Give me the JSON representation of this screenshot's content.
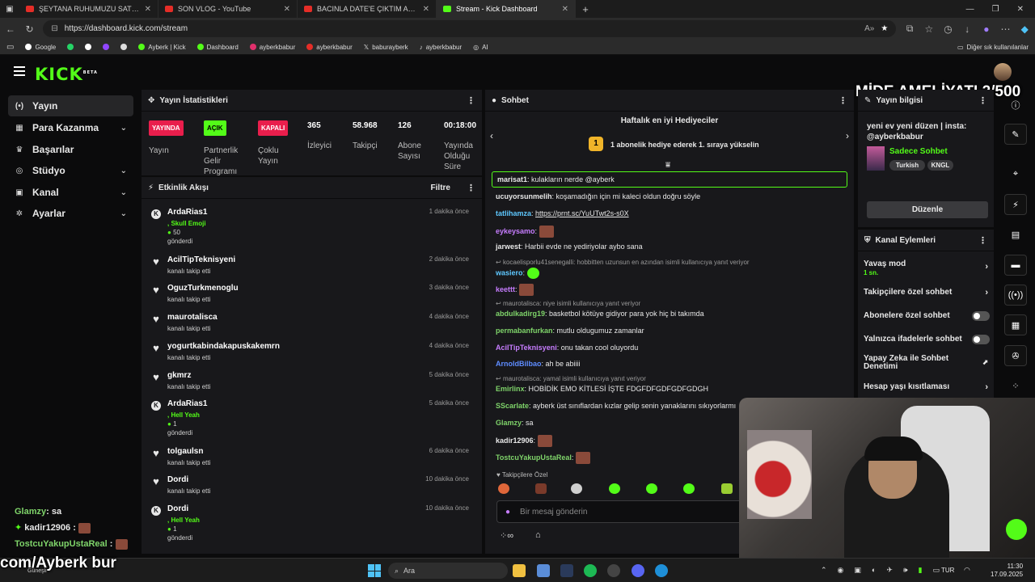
{
  "browser": {
    "tabs": [
      {
        "title": "ŞEYTANA RUHUMUZU SATTIK - Y",
        "kind": "yt"
      },
      {
        "title": "SON VLOG - YouTube",
        "kind": "yt"
      },
      {
        "title": "BACINLA DATE'E ÇIKTIM ALİ BİÇİM",
        "kind": "yt"
      },
      {
        "title": "Stream - Kick Dashboard",
        "kind": "kick"
      }
    ],
    "url": "https://dashboard.kick.com/stream",
    "bookmarks": [
      "Google",
      "Ayberk | Kick",
      "Dashboard",
      "ayberkbabur",
      "ayberkbabur",
      "baburayberk",
      "ayberkbabur",
      "AI"
    ],
    "bookmarks_other": "Diğer sık kullanılanlar"
  },
  "overlay": {
    "title": "MİDE AMELİYATI 2/500",
    "watermark": "com/Ayberk bur"
  },
  "sidebar": {
    "items": [
      {
        "label": "Yayın",
        "icon": "broadcast-icon",
        "glyph": "(•)",
        "active": true,
        "chevron": false
      },
      {
        "label": "Para Kazanma",
        "icon": "money-icon",
        "glyph": "▦",
        "active": false,
        "chevron": true
      },
      {
        "label": "Başarılar",
        "icon": "trophy-icon",
        "glyph": "♛",
        "active": false,
        "chevron": false
      },
      {
        "label": "Stüdyo",
        "icon": "studio-icon",
        "glyph": "◎",
        "active": false,
        "chevron": true
      },
      {
        "label": "Kanal",
        "icon": "channel-icon",
        "glyph": "▣",
        "active": false,
        "chevron": true
      },
      {
        "label": "Ayarlar",
        "icon": "settings-icon",
        "glyph": "✲",
        "active": false,
        "chevron": true
      }
    ],
    "mini_chat": [
      {
        "user": "Glamzy",
        "text": ": sa",
        "color": "#7fd46a"
      },
      {
        "user": "kadir12906",
        "text": " :",
        "color": "#e8e8e8"
      },
      {
        "user": "TostcuYakupUstaReal",
        "text": " :",
        "color": "#7fd46a"
      }
    ]
  },
  "stats": {
    "title": "Yayın İstatistikleri",
    "items": [
      {
        "badge": "YAYINDA",
        "badge_color": "red",
        "label": "Yayın"
      },
      {
        "badge": "AÇIK",
        "badge_color": "green",
        "label": "Partnerlik Gelir Programı"
      },
      {
        "badge": "KAPALI",
        "badge_color": "red",
        "label": "Çoklu Yayın"
      },
      {
        "value": "365",
        "label": "İzleyici"
      },
      {
        "value": "58.968",
        "label": "Takipçi"
      },
      {
        "value": "126",
        "label": "Abone Sayısı"
      },
      {
        "value": "00:18:00",
        "label": "Yayında Olduğu Süre"
      }
    ]
  },
  "activity": {
    "title": "Etkinlik Akışı",
    "filter": "Filtre",
    "items": [
      {
        "name": "ArdaRias1",
        "type": "gift",
        "line1": ", Skull Emoji",
        "line2": "50",
        "line3": "gönderdi",
        "time": "1 dakika önce"
      },
      {
        "name": "AcilTipTeknisyeni",
        "type": "follow",
        "line1": "kanalı takip etti",
        "time": "2 dakika önce"
      },
      {
        "name": "OguzTurkmenoglu",
        "type": "follow",
        "line1": "kanalı takip etti",
        "time": "3 dakika önce"
      },
      {
        "name": "maurotalisca",
        "type": "follow",
        "line1": "kanalı takip etti",
        "time": "4 dakika önce"
      },
      {
        "name": "yogurtkabindakapuskakemrn",
        "type": "follow",
        "line1": "kanalı takip etti",
        "time": "4 dakika önce"
      },
      {
        "name": "gkmrz",
        "type": "follow",
        "line1": "kanalı takip etti",
        "time": "5 dakika önce"
      },
      {
        "name": "ArdaRias1",
        "type": "gift",
        "line1": ", Hell Yeah",
        "line2": "1",
        "line3": "gönderdi",
        "time": "5 dakika önce"
      },
      {
        "name": "tolgaulsn",
        "type": "follow",
        "line1": "kanalı takip etti",
        "time": "6 dakika önce"
      },
      {
        "name": "Dordi",
        "type": "follow",
        "line1": "kanalı takip etti",
        "time": "10 dakika önce"
      },
      {
        "name": "Dordi",
        "type": "gift",
        "line1": ", Hell Yeah",
        "line2": "1",
        "line3": "gönderdi",
        "time": "10 dakika önce"
      }
    ]
  },
  "chat": {
    "title": "Sohbet",
    "gifters_title": "Haftalık en iyi Hediyeciler",
    "gifters_rank": "1",
    "gifters_text": "1 abonelik hediye ederek 1. sıraya yükselin",
    "highlight": {
      "user": "marisat1",
      "text": ": kulakların nerde @ayberk"
    },
    "lines": [
      {
        "kind": "msg",
        "user": "ucuyorsunmelih",
        "text": ": koşamadığın için mi kaleci oldun doğru söyle",
        "color": "#e8e8e8"
      },
      {
        "kind": "msg",
        "user": "tatlihamza",
        "text": ": ",
        "link": "https://prnt.sc/YuUTwt2s-s0X",
        "color": "#5ec8ff"
      },
      {
        "kind": "msg",
        "user": "eykeysamo",
        "text": ": ",
        "emote": true,
        "color": "#c77dff"
      },
      {
        "kind": "msg",
        "user": "jarwest",
        "text": ": Harbii evde ne yediriyolar aybo sana",
        "color": "#e8e8e8"
      },
      {
        "kind": "reply",
        "text": "kocaelisporlu41senegalli: hobbitten uzunsun en azından isimli kullanıcıya yanıt veriyor"
      },
      {
        "kind": "msg",
        "user": "wasiero",
        "text": ": ",
        "emote_green": true,
        "color": "#5ec8ff"
      },
      {
        "kind": "msg",
        "user": "keettt",
        "text": ": ",
        "emote": true,
        "color": "#c77dff"
      },
      {
        "kind": "reply",
        "text": "maurotalisca: niye isimli kullanıcıya yanıt veriyor"
      },
      {
        "kind": "msg",
        "user": "abdulkadirg19",
        "text": ": basketbol kötüye gidiyor para yok hiç bi takımda",
        "color": "#7fd46a"
      },
      {
        "kind": "msg",
        "user": "permabanfurkan",
        "text": ": mutlu oldugumuz zamanlar",
        "color": "#7fd46a"
      },
      {
        "kind": "msg",
        "user": "AcilTipTeknisyeni",
        "text": ": onu takan cool oluyordu",
        "color": "#c77dff"
      },
      {
        "kind": "msg",
        "user": "ArnoldBilbao",
        "text": ": ah be abiiii",
        "color": "#5e8cff"
      },
      {
        "kind": "reply",
        "text": "maurotalisca: yamal isimli kullanıcıya yanıt veriyor"
      },
      {
        "kind": "msg",
        "user": "Emirlinx",
        "text": ": HOBİDİK EMO KİTLESİ İŞTE FDGFDFGDFGDFGDGH",
        "color": "#7fd46a"
      },
      {
        "kind": "msg",
        "user": "SScarlate",
        "text": ": ayberk üst sınıflardan kızlar gelip senin yanaklarını sıkıyorlarmı",
        "color": "#7fd46a"
      },
      {
        "kind": "msg",
        "user": "Glamzy",
        "text": ": sa",
        "color": "#7fd46a"
      },
      {
        "kind": "msg",
        "user": "kadir12906",
        "text": ": ",
        "emote": true,
        "color": "#e8e8e8"
      },
      {
        "kind": "msg",
        "user": "TostcuYakupUstaReal",
        "text": ": ",
        "emote": true,
        "color": "#7fd46a"
      }
    ],
    "followers_only": "Takipçilere Özel",
    "input_placeholder": "Bir mesaj gönderin"
  },
  "stream_info": {
    "title": "Yayın bilgisi",
    "stream_title": "yeni ev yeni düzen | insta: @ayberkbabur",
    "category": "Sadece Sohbet",
    "tags": [
      "Turkish",
      "KNGL"
    ],
    "edit": "Düzenle"
  },
  "channel_actions": {
    "title": "Kanal Eylemleri",
    "items": [
      {
        "label": "Yavaş mod",
        "sub": "1 sn.",
        "control": "chevron"
      },
      {
        "label": "Takipçilere özel sohbet",
        "control": "chevron"
      },
      {
        "label": "Abonelere özel sohbet",
        "control": "toggle"
      },
      {
        "label": "Yalnızca ifadelerle sohbet",
        "control": "toggle"
      },
      {
        "label": "Yapay Zeka ile Sohbet Denetimi",
        "control": "external"
      },
      {
        "label": "Hesap yaşı kısıtlaması",
        "control": "chevron"
      }
    ]
  },
  "taskbar": {
    "weather": "Güneşli",
    "search": "Ara",
    "lang": "TUR",
    "time": "11:30",
    "date": "17.09.2025"
  }
}
